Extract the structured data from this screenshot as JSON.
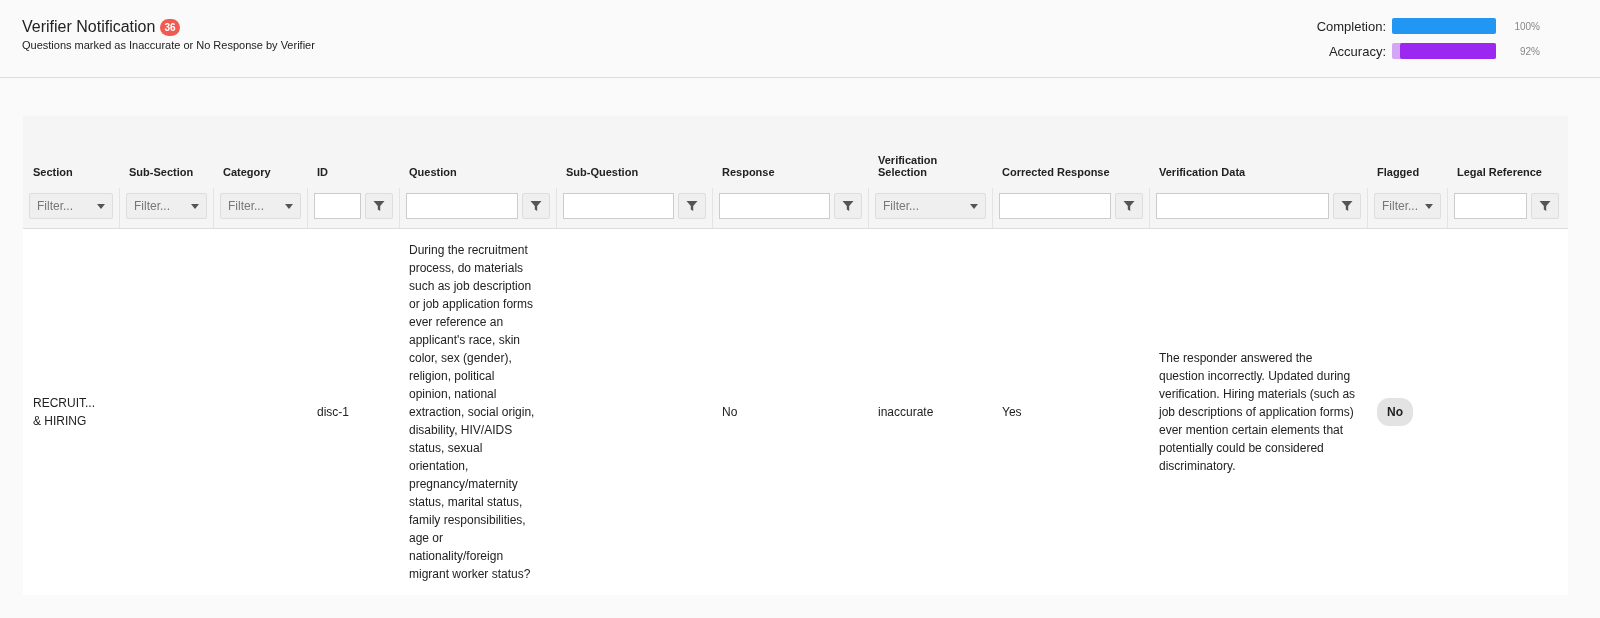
{
  "header": {
    "title": "Verifier Notification",
    "badge": "36",
    "subtitle": "Questions marked as Inaccurate or No Response by Verifier"
  },
  "progress": [
    {
      "label": "Completion:",
      "level": 1.0,
      "reading": "100%",
      "color": "#2196f3"
    },
    {
      "label": "Accuracy:",
      "level": 0.92,
      "reading": "92%",
      "color": "#9c27f0"
    }
  ],
  "table": {
    "columns": [
      {
        "title": "Section",
        "filter": {
          "kind": "select",
          "placeholder": "Filter..."
        }
      },
      {
        "title": "Sub-Section",
        "filter": {
          "kind": "select",
          "placeholder": "Filter..."
        }
      },
      {
        "title": "Category",
        "filter": {
          "kind": "select",
          "placeholder": "Filter..."
        }
      },
      {
        "title": "ID",
        "filter": {
          "kind": "text"
        }
      },
      {
        "title": "Question",
        "filter": {
          "kind": "text"
        }
      },
      {
        "title": "Sub-Question",
        "filter": {
          "kind": "text"
        }
      },
      {
        "title": "Response",
        "filter": {
          "kind": "text"
        }
      },
      {
        "title": "Verification Selection",
        "filter": {
          "kind": "select",
          "placeholder": "Filter..."
        }
      },
      {
        "title": "Corrected Response",
        "filter": {
          "kind": "text"
        }
      },
      {
        "title": "Verification Data",
        "filter": {
          "kind": "text"
        }
      },
      {
        "title": "Flagged",
        "filter": {
          "kind": "select",
          "placeholder": "Filter..."
        }
      },
      {
        "title": "Legal Reference",
        "filter": {
          "kind": "text"
        }
      }
    ],
    "rows": [
      {
        "cells": [
          {
            "kind": "text",
            "text": "RECRUIT... & HIRING"
          },
          {
            "kind": "text",
            "text": ""
          },
          {
            "kind": "text",
            "text": ""
          },
          {
            "kind": "text",
            "text": "disc-1"
          },
          {
            "kind": "text",
            "text": "During the recruitment process, do materials such as job description or job application forms ever reference an applicant's race, skin color, sex (gender), religion, political opinion, national extraction, social origin, disability, HIV/AIDS status, sexual orientation, pregnancy/maternity status, marital status, family responsibilities, age or nationality/foreign migrant worker status?"
          },
          {
            "kind": "text",
            "text": ""
          },
          {
            "kind": "text",
            "text": "No"
          },
          {
            "kind": "text",
            "text": "inaccurate"
          },
          {
            "kind": "text",
            "text": "Yes"
          },
          {
            "kind": "text",
            "text": "The responder answered the question incorrectly. Updated during verification. Hiring materials (such as job descriptions of application forms) ever mention certain elements that potentially could be considered discriminatory."
          },
          {
            "kind": "pill",
            "text": "No"
          },
          {
            "kind": "text",
            "text": ""
          }
        ]
      }
    ]
  }
}
